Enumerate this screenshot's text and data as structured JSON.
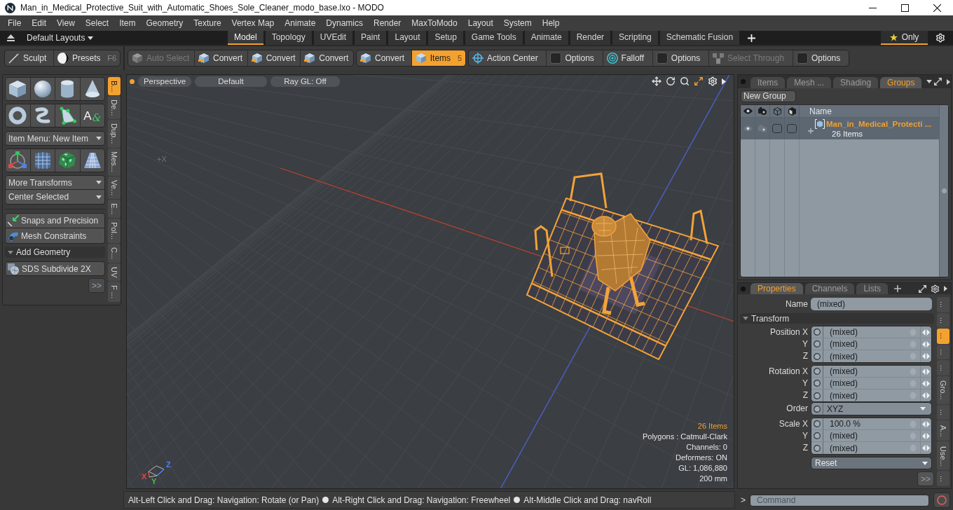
{
  "window": {
    "title": "Man_in_Medical_Protective_Suit_with_Automatic_Shoes_Sole_Cleaner_modo_base.lxo - MODO"
  },
  "menu": [
    "File",
    "Edit",
    "View",
    "Select",
    "Item",
    "Geometry",
    "Texture",
    "Vertex Map",
    "Animate",
    "Dynamics",
    "Render",
    "MaxToModo",
    "Layout",
    "System",
    "Help"
  ],
  "layout_bar": {
    "layouts": "Default Layouts",
    "tabs": [
      {
        "label": "Model",
        "selected": true
      },
      {
        "label": "Topology",
        "selected": false
      },
      {
        "label": "UVEdit",
        "selected": false
      },
      {
        "label": "Paint",
        "selected": false
      },
      {
        "label": "Layout",
        "selected": false
      },
      {
        "label": "Setup",
        "selected": false
      },
      {
        "label": "Game Tools",
        "selected": false
      },
      {
        "label": "Animate",
        "selected": false
      },
      {
        "label": "Render",
        "selected": false
      },
      {
        "label": "Scripting",
        "selected": false
      },
      {
        "label": "Schematic Fusion",
        "selected": false
      }
    ],
    "only": {
      "label": "Only",
      "on": true
    }
  },
  "toolbar": {
    "groups": [
      {
        "items": [
          {
            "label": "Sculpt",
            "kind": "sculpt",
            "selected": false,
            "disabled": false
          },
          {
            "label": "Presets",
            "kind": "presets",
            "shortcut": "F6",
            "selected": false,
            "disabled": false
          }
        ]
      },
      {
        "items": [
          {
            "label": "Auto Select",
            "kind": "select",
            "selected": false,
            "disabled": true
          },
          {
            "label": "Convert",
            "kind": "convert",
            "selected": false,
            "disabled": false
          },
          {
            "label": "Convert",
            "kind": "convert",
            "selected": false,
            "disabled": false
          },
          {
            "label": "Convert",
            "kind": "convert",
            "selected": false,
            "disabled": false
          }
        ]
      },
      {
        "items": [
          {
            "label": "Convert",
            "kind": "convert",
            "selected": false,
            "disabled": false
          },
          {
            "label": "Items",
            "kind": "items",
            "shortcut": "5",
            "selected": true,
            "disabled": false
          }
        ]
      },
      {
        "items": [
          {
            "label": "Action Center",
            "kind": "center",
            "selected": false,
            "disabled": false
          },
          {
            "label": "Options",
            "kind": "options",
            "selected": false,
            "disabled": false
          },
          {
            "label": "Falloff",
            "kind": "falloff",
            "selected": false,
            "disabled": false
          },
          {
            "label": "Options",
            "kind": "options",
            "selected": false,
            "disabled": false
          },
          {
            "label": "Select Through",
            "kind": "through",
            "selected": false,
            "disabled": true
          },
          {
            "label": "Options",
            "kind": "options",
            "selected": false,
            "disabled": false
          }
        ]
      }
    ]
  },
  "tool_panel": {
    "text_tool": {
      "letter": "A",
      "mark": "&"
    },
    "item_menu": "Item Menu: New Item",
    "transform_menus": [
      "More Transforms",
      "Center Selected"
    ],
    "buttons": [
      "Snaps and Precision",
      "Mesh Constraints"
    ],
    "section": {
      "label": "Add Geometry",
      "expanded": true
    },
    "subdivide": "SDS Subdivide 2X",
    "more": ">>",
    "side_tabs": [
      {
        "label": "B...",
        "selected": true
      },
      {
        "label": "De...",
        "selected": false
      },
      {
        "label": "Dup...",
        "selected": false
      },
      {
        "label": "Mes...",
        "selected": false
      },
      {
        "label": "Ve...",
        "selected": false
      },
      {
        "label": "E...",
        "selected": false
      },
      {
        "label": "Pol...",
        "selected": false
      },
      {
        "label": "C...",
        "selected": false
      },
      {
        "label": "UV",
        "selected": false
      },
      {
        "label": "F ...",
        "selected": false
      }
    ]
  },
  "viewport": {
    "header": [
      "Perspective",
      "Default",
      "Ray GL: Off"
    ],
    "axis_label": "+X",
    "gizmo_axes": [
      {
        "label": "X",
        "color": "#e04848"
      },
      {
        "label": "Y",
        "color": "#48c048"
      },
      {
        "label": "Z",
        "color": "#4f7fff"
      }
    ],
    "info": [
      {
        "text": "26 Items",
        "highlight": true
      },
      {
        "text": "Polygons : Catmull-Clark",
        "highlight": false
      },
      {
        "text": "Channels: 0",
        "highlight": false
      },
      {
        "text": "Deformers: ON",
        "highlight": false
      },
      {
        "text": "GL: 1,086,880",
        "highlight": false
      },
      {
        "text": "200 mm",
        "highlight": false
      }
    ]
  },
  "groups_panel": {
    "tabs": [
      {
        "label": "Items",
        "selected": false
      },
      {
        "label": "Mesh ...",
        "selected": false
      },
      {
        "label": "Shading",
        "selected": false
      },
      {
        "label": "Groups",
        "selected": true
      }
    ],
    "new_group": "New Group",
    "name_column": "Name",
    "rows": [
      {
        "name": "Man_in_Medical_Protecti ...",
        "count": "26 Items",
        "selected": true
      }
    ]
  },
  "properties_panel": {
    "tabs": [
      {
        "label": "Properties",
        "selected": true
      },
      {
        "label": "Channels",
        "selected": false
      },
      {
        "label": "Lists",
        "selected": false
      }
    ],
    "name": {
      "label": "Name",
      "value": "(mixed)"
    },
    "section": {
      "label": "Transform",
      "expanded": true
    },
    "groups": [
      {
        "kind": "vector",
        "rows": [
          {
            "label": "Position X",
            "value": "(mixed)"
          },
          {
            "label": "Y",
            "value": "(mixed)"
          },
          {
            "label": "Z",
            "value": "(mixed)"
          }
        ]
      },
      {
        "kind": "vector",
        "rows": [
          {
            "label": "Rotation X",
            "value": "(mixed)"
          },
          {
            "label": "Y",
            "value": "(mixed)"
          },
          {
            "label": "Z",
            "value": "(mixed)"
          }
        ]
      },
      {
        "kind": "select",
        "rows": [
          {
            "label": "Order",
            "value": "XYZ"
          }
        ]
      },
      {
        "kind": "vector",
        "rows": [
          {
            "label": "Scale X",
            "value": "100.0 %"
          },
          {
            "label": "Y",
            "value": "(mixed)"
          },
          {
            "label": "Z",
            "value": "(mixed)"
          }
        ]
      }
    ],
    "reset": "Reset",
    "more": ">>",
    "side_tabs": [
      {
        "label": "...",
        "selected": false
      },
      {
        "label": "...",
        "selected": false
      },
      {
        "label": "...",
        "selected": true
      },
      {
        "label": "...",
        "selected": false
      },
      {
        "label": "...",
        "selected": false
      },
      {
        "label": "Gro...",
        "selected": false
      },
      {
        "label": "...",
        "selected": false
      },
      {
        "label": "A...",
        "selected": false
      },
      {
        "label": "Use...",
        "selected": false
      },
      {
        "label": "...",
        "selected": false
      }
    ]
  },
  "command_bar": {
    "prompt": ">",
    "placeholder": "Command"
  },
  "status_bar": {
    "hints": [
      "Alt-Left Click and Drag: Navigation: Rotate (or Pan)",
      "Alt-Right Click and Drag: Navigation: Freewheel",
      "Alt-Middle Click and Drag: navRoll"
    ]
  }
}
